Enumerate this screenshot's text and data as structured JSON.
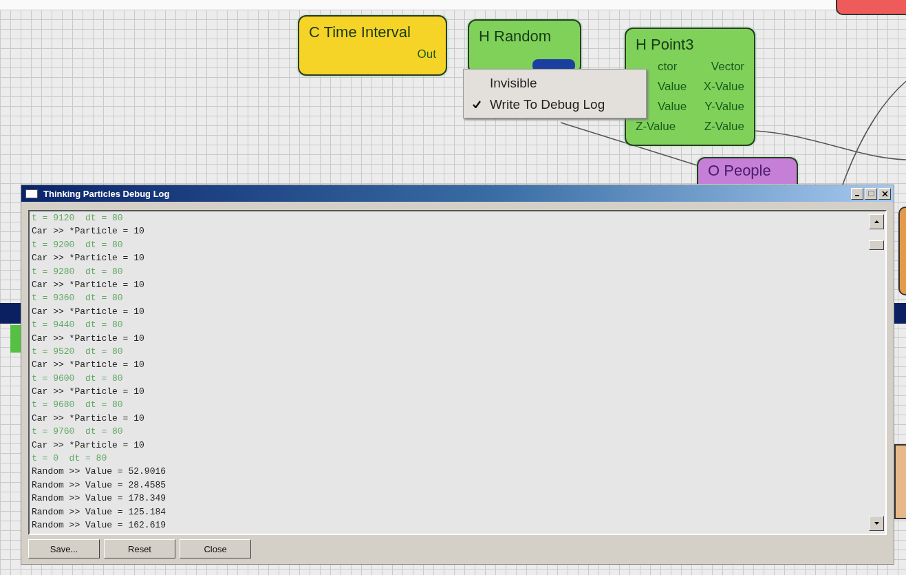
{
  "nodes": [
    {
      "title": "C Time Interval",
      "color": "#f5d327",
      "rows": [
        [
          "",
          "Out"
        ]
      ]
    },
    {
      "title": "H Random",
      "color": "#7fd15a"
    },
    {
      "title": "H Point3",
      "color": "#7fd15a",
      "rows": [
        [
          "ctor",
          "Vector"
        ],
        [
          "Value",
          "X-Value"
        ],
        [
          "Value",
          "Y-Value"
        ],
        [
          "Z-Value",
          "Z-Value"
        ]
      ]
    },
    {
      "title": "O People",
      "color": "#c67fd6"
    }
  ],
  "context_menu": {
    "items": [
      {
        "label": "Invisible",
        "checked": false
      },
      {
        "label": "Write To Debug Log",
        "checked": true
      }
    ]
  },
  "debug_window": {
    "title": "Thinking Particles Debug Log",
    "log": [
      {
        "kind": "time",
        "text": "t = 9120  dt = 80"
      },
      {
        "kind": "event",
        "text": "Car >> *Particle = 10"
      },
      {
        "kind": "time",
        "text": "t = 9200  dt = 80"
      },
      {
        "kind": "event",
        "text": "Car >> *Particle = 10"
      },
      {
        "kind": "time",
        "text": "t = 9280  dt = 80"
      },
      {
        "kind": "event",
        "text": "Car >> *Particle = 10"
      },
      {
        "kind": "time",
        "text": "t = 9360  dt = 80"
      },
      {
        "kind": "event",
        "text": "Car >> *Particle = 10"
      },
      {
        "kind": "time",
        "text": "t = 9440  dt = 80"
      },
      {
        "kind": "event",
        "text": "Car >> *Particle = 10"
      },
      {
        "kind": "time",
        "text": "t = 9520  dt = 80"
      },
      {
        "kind": "event",
        "text": "Car >> *Particle = 10"
      },
      {
        "kind": "time",
        "text": "t = 9600  dt = 80"
      },
      {
        "kind": "event",
        "text": "Car >> *Particle = 10"
      },
      {
        "kind": "time",
        "text": "t = 9680  dt = 80"
      },
      {
        "kind": "event",
        "text": "Car >> *Particle = 10"
      },
      {
        "kind": "time",
        "text": "t = 9760  dt = 80"
      },
      {
        "kind": "event",
        "text": "Car >> *Particle = 10"
      },
      {
        "kind": "time",
        "text": "t = 0  dt = 80"
      },
      {
        "kind": "event",
        "text": "Random >> Value = 52.9016"
      },
      {
        "kind": "event",
        "text": "Random >> Value = 28.4585"
      },
      {
        "kind": "event",
        "text": "Random >> Value = 178.349"
      },
      {
        "kind": "event",
        "text": "Random >> Value = 125.184"
      },
      {
        "kind": "event",
        "text": "Random >> Value = 162.619"
      }
    ],
    "buttons": [
      "Save...",
      "Reset",
      "Close"
    ]
  }
}
